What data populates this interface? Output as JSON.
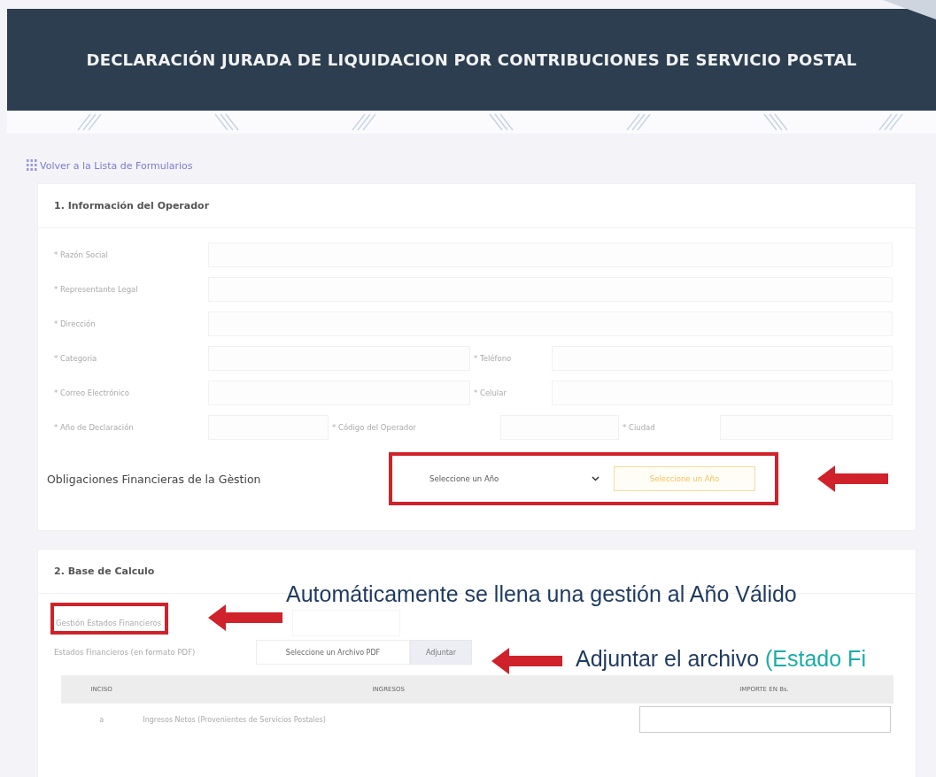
{
  "header": {
    "title": "DECLARACIÓN JURADA DE LIQUIDACION POR CONTRIBUCIONES DE SERVICIO POSTAL"
  },
  "back_link": {
    "label": "Volver a la Lista de Formularios"
  },
  "section_1": {
    "title": "1. Información del Operador",
    "rows": [
      [
        {
          "label": "* Razón Social"
        }
      ],
      [
        {
          "label": "* Representante Legal"
        }
      ],
      [
        {
          "label": "* Dirección"
        }
      ],
      [
        {
          "label": "* Categoria"
        },
        {
          "label": "* Teléfono"
        }
      ],
      [
        {
          "label": "* Correo Electrónico"
        },
        {
          "label": "* Celular"
        }
      ],
      [
        {
          "label": "* Año de Declaración"
        },
        {
          "label": "* Código del Operador"
        },
        {
          "label": "* Ciudad"
        }
      ]
    ],
    "obligations": {
      "label": "Obligaciones Financieras de la Gèstion",
      "select_value": "Seleccione un Año",
      "button": "Seleccione un Año",
      "highlighted": true
    }
  },
  "section_2": {
    "title": "2. Base de Calculo",
    "gestion": {
      "label": "Gestión Estados Financieros",
      "highlighted": true
    },
    "file": {
      "label": "Estados Financieros (en formato PDF)",
      "placeholder": "Seleccione un Archivo PDF",
      "button": "Adjuntar"
    },
    "table": {
      "columns": [
        "INCISO",
        "INGRESOS",
        "IMPORTE EN Bs."
      ],
      "rows": [
        {
          "inciso": "a",
          "ingresos": "Ingresos Netos (Provenientes de Servicios Postales)"
        }
      ]
    }
  },
  "annotations": [
    {
      "text": "Automáticamente se llena una gestión al Año Válido"
    },
    {
      "text": "Adjuntar el archivo",
      "highlight": "(Estado Fi"
    }
  ]
}
